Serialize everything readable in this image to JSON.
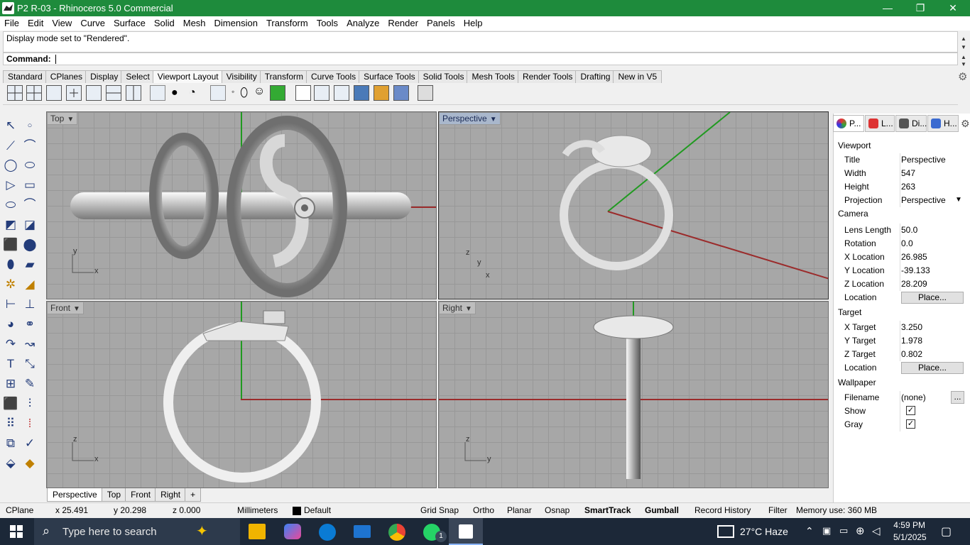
{
  "window": {
    "title": "P2 R-03 - Rhinoceros 5.0 Commercial",
    "minimize": "—",
    "restore": "❐",
    "close": "✕"
  },
  "menu": [
    "File",
    "Edit",
    "View",
    "Curve",
    "Surface",
    "Solid",
    "Mesh",
    "Dimension",
    "Transform",
    "Tools",
    "Analyze",
    "Render",
    "Panels",
    "Help"
  ],
  "history": {
    "text": "Display mode set to \"Rendered\"."
  },
  "command": {
    "label": "Command:",
    "value": ""
  },
  "toolbar_tabs": [
    "Standard",
    "CPlanes",
    "Display",
    "Select",
    "Viewport Layout",
    "Visibility",
    "Transform",
    "Curve Tools",
    "Surface Tools",
    "Solid Tools",
    "Mesh Tools",
    "Render Tools",
    "Drafting",
    "New in V5"
  ],
  "active_tab": "Viewport Layout",
  "viewports": {
    "top": {
      "label": "Top",
      "ax1": "y",
      "ax2": "x"
    },
    "perspective": {
      "label": "Perspective",
      "ax1": "z",
      "ax2": "y",
      "ax3": "x"
    },
    "front": {
      "label": "Front",
      "ax1": "z",
      "ax2": "x"
    },
    "right": {
      "label": "Right",
      "ax1": "z",
      "ax2": "y"
    }
  },
  "viewport_tabs": [
    "Perspective",
    "Top",
    "Front",
    "Right",
    "+"
  ],
  "panel": {
    "tabs": [
      "P...",
      "L...",
      "Di...",
      "H..."
    ],
    "sections": {
      "viewport": "Viewport",
      "camera": "Camera",
      "target": "Target",
      "wallpaper": "Wallpaper"
    },
    "rows": {
      "title": {
        "k": "Title",
        "v": "Perspective"
      },
      "width": {
        "k": "Width",
        "v": "547"
      },
      "height": {
        "k": "Height",
        "v": "263"
      },
      "projection": {
        "k": "Projection",
        "v": "Perspective"
      },
      "lens": {
        "k": "Lens Length",
        "v": "50.0"
      },
      "rotation": {
        "k": "Rotation",
        "v": "0.0"
      },
      "xloc": {
        "k": "X Location",
        "v": "26.985"
      },
      "yloc": {
        "k": "Y Location",
        "v": "-39.133"
      },
      "zloc": {
        "k": "Z Location",
        "v": "28.209"
      },
      "camloc": {
        "k": "Location",
        "v": "Place..."
      },
      "xtar": {
        "k": "X Target",
        "v": "3.250"
      },
      "ytar": {
        "k": "Y Target",
        "v": "1.978"
      },
      "ztar": {
        "k": "Z Target",
        "v": "0.802"
      },
      "tarloc": {
        "k": "Location",
        "v": "Place..."
      },
      "filename": {
        "k": "Filename",
        "v": "(none)",
        "btn": "..."
      },
      "show": {
        "k": "Show",
        "v": "✓"
      },
      "gray": {
        "k": "Gray",
        "v": "✓"
      }
    }
  },
  "status": {
    "cplane": "CPlane",
    "x": "x 25.491",
    "y": "y 20.298",
    "z": "z 0.000",
    "units": "Millimeters",
    "layer": "Default",
    "grid_snap": "Grid Snap",
    "ortho": "Ortho",
    "planar": "Planar",
    "osnap": "Osnap",
    "smarttrack": "SmartTrack",
    "gumball": "Gumball",
    "record_history": "Record History",
    "filter": "Filter",
    "memory": "Memory use: 360 MB"
  },
  "taskbar": {
    "search_placeholder": "Type here to search",
    "weather": "27°C  Haze",
    "time": "4:59 PM",
    "date": "5/1/2025",
    "whatsapp_badge": "1"
  }
}
